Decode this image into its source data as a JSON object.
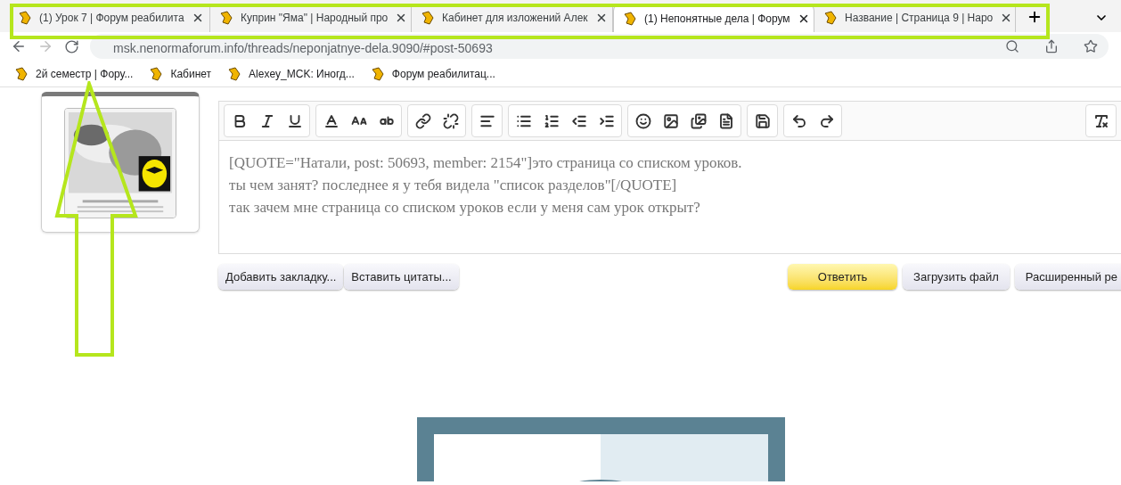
{
  "tabs": [
    {
      "title": "(1) Урок 7 | Форум реабилита",
      "selected": false
    },
    {
      "title": "Куприн \"Яма\" | Народный про",
      "selected": false
    },
    {
      "title": "Кабинет для изложений Алек",
      "selected": false
    },
    {
      "title": "(1) Непонятные дела | Форум",
      "selected": true
    },
    {
      "title": "Название | Страница 9 | Наро",
      "selected": false
    }
  ],
  "address_bar": {
    "url": "msk.nenormaforum.info/threads/neponjatnye-dela.9090/#post-50693"
  },
  "bookmarks": [
    "2й семестр | Фору...",
    "Кабинет",
    "Alexey_MCK: Иногд...",
    "Форум реабилитац..."
  ],
  "avatar": {
    "kind": "picture"
  },
  "editor": {
    "lines": [
      "[QUOTE=\"Натали, post: 50693, member: 2154\"]это страница со списком уроков.",
      "ты чем занят? последнее я у тебя видела \"список разделов\"[/QUOTE]",
      "так зачем мне страница со списком уроков если у меня сам урок открыт?"
    ]
  },
  "left_buttons": [
    "Добавить закладку...",
    "Вставить цитаты..."
  ],
  "right_buttons": [
    {
      "label": "Ответить",
      "kind": "primary"
    },
    {
      "label": "Загрузить файл",
      "kind": "secondary"
    },
    {
      "label": "Расширенный ре",
      "kind": "secondary"
    }
  ],
  "illustration": {
    "kind": "picture"
  }
}
